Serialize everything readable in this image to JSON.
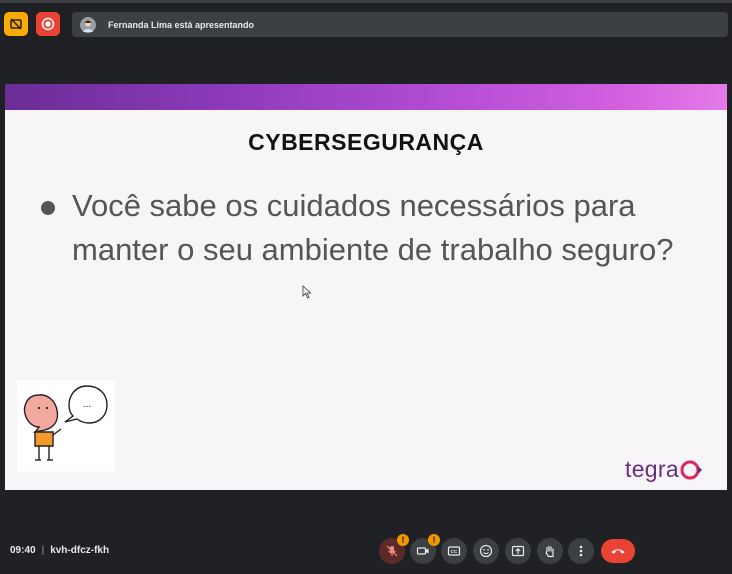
{
  "presenter": {
    "text": "Fernanda Lima está apresentando"
  },
  "slide": {
    "title": "CYBERSEGURANÇA",
    "bullet": "Você sabe os cuidados necessários para manter o seu ambiente de trabalho seguro?",
    "speech_bubble": "...",
    "logo_text": "tegra",
    "band_colors": [
      "#6a2d96",
      "#e57ae8"
    ]
  },
  "meeting": {
    "time": "09:40",
    "separator": "|",
    "code": "kvh-dfcz-fkh"
  },
  "controls": {
    "mic_badge": "!",
    "camera_badge": "!",
    "items": [
      "microphone",
      "camera",
      "captions",
      "emoji-reactions",
      "present-screen",
      "raise-hand",
      "more-options",
      "leave-call"
    ]
  },
  "colors": {
    "end_call": "#ea4335",
    "stop_presenting": "#ea4335",
    "warning": "#f9ab00"
  }
}
